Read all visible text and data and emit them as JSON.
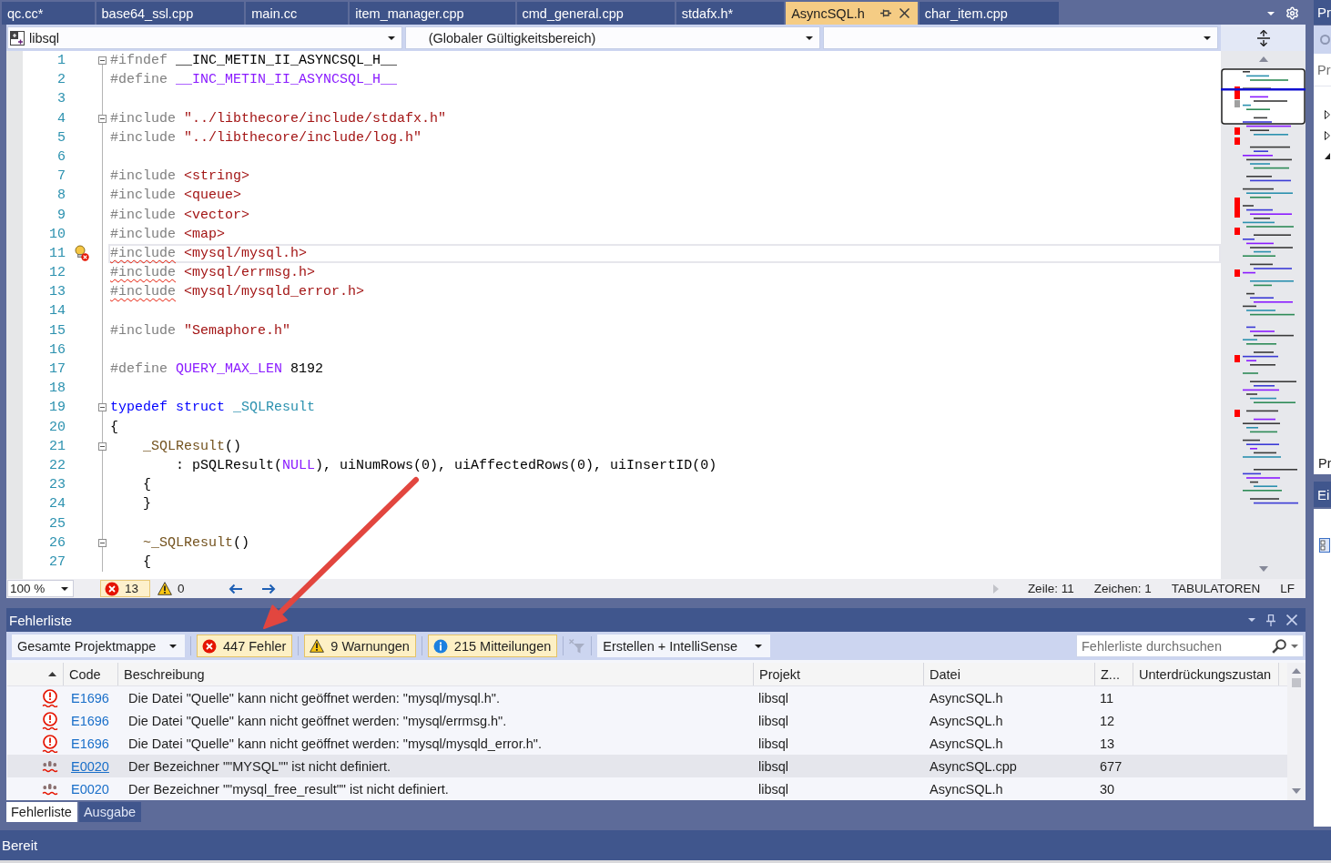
{
  "document_tabs": [
    {
      "label": "qc.cc*",
      "selected": false
    },
    {
      "label": "base64_ssl.cpp",
      "selected": false
    },
    {
      "label": "main.cc",
      "selected": false
    },
    {
      "label": "item_manager.cpp",
      "selected": false
    },
    {
      "label": "cmd_general.cpp",
      "selected": false
    },
    {
      "label": "stdafx.h*",
      "selected": false
    },
    {
      "label": "AsyncSQL.h",
      "selected": true
    },
    {
      "label": "char_item.cpp",
      "selected": false
    }
  ],
  "navigation_bar": {
    "project": "libsql",
    "scope": "(Globaler Gültigkeitsbereich)"
  },
  "editor": {
    "lines": [
      {
        "number": "1",
        "fold": true,
        "current": false,
        "error": false,
        "tokens": [
          {
            "text": "#ifndef",
            "kind": "preprocessor"
          },
          {
            "text": " __INC_METIN_II_ASYNCSQL_H__",
            "kind": "plain"
          }
        ]
      },
      {
        "number": "2",
        "fold": false,
        "current": false,
        "error": false,
        "tokens": [
          {
            "text": "#define",
            "kind": "preprocessor"
          },
          {
            "text": " __INC_METIN_II_ASYNCSQL_H__",
            "kind": "macro"
          }
        ]
      },
      {
        "number": "3",
        "fold": false,
        "current": false,
        "error": false
      },
      {
        "number": "4",
        "fold": true,
        "current": false,
        "error": false,
        "tokens": [
          {
            "text": "#include",
            "kind": "preprocessor"
          },
          {
            "text": " \"../libthecore/include/stdafx.h\"",
            "kind": "string"
          }
        ]
      },
      {
        "number": "5",
        "fold": false,
        "current": false,
        "error": false,
        "tokens": [
          {
            "text": "#include",
            "kind": "preprocessor"
          },
          {
            "text": " \"../libthecore/include/log.h\"",
            "kind": "string"
          }
        ]
      },
      {
        "number": "6",
        "fold": false,
        "current": false,
        "error": false
      },
      {
        "number": "7",
        "fold": false,
        "current": false,
        "error": false,
        "tokens": [
          {
            "text": "#include",
            "kind": "preprocessor"
          },
          {
            "text": " <string>",
            "kind": "string"
          }
        ]
      },
      {
        "number": "8",
        "fold": false,
        "current": false,
        "error": false,
        "tokens": [
          {
            "text": "#include",
            "kind": "preprocessor"
          },
          {
            "text": " <queue>",
            "kind": "string"
          }
        ]
      },
      {
        "number": "9",
        "fold": false,
        "current": false,
        "error": false,
        "tokens": [
          {
            "text": "#include",
            "kind": "preprocessor"
          },
          {
            "text": " <vector>",
            "kind": "string"
          }
        ]
      },
      {
        "number": "10",
        "fold": false,
        "current": false,
        "error": false,
        "tokens": [
          {
            "text": "#include",
            "kind": "preprocessor"
          },
          {
            "text": " <map>",
            "kind": "string"
          }
        ]
      },
      {
        "number": "11",
        "fold": false,
        "current": true,
        "error": true,
        "tokens": [
          {
            "text": "#include",
            "kind": "preprocessor"
          },
          {
            "text": " <mysql/mysql.h>",
            "kind": "string"
          }
        ]
      },
      {
        "number": "12",
        "fold": false,
        "current": false,
        "error": true,
        "tokens": [
          {
            "text": "#include",
            "kind": "preprocessor"
          },
          {
            "text": " <mysql/errmsg.h>",
            "kind": "string"
          }
        ]
      },
      {
        "number": "13",
        "fold": false,
        "current": false,
        "error": true,
        "tokens": [
          {
            "text": "#include",
            "kind": "preprocessor"
          },
          {
            "text": " <mysql/mysqld_error.h>",
            "kind": "string"
          }
        ]
      },
      {
        "number": "14",
        "fold": false,
        "current": false,
        "error": false
      },
      {
        "number": "15",
        "fold": false,
        "current": false,
        "error": false,
        "tokens": [
          {
            "text": "#include",
            "kind": "preprocessor"
          },
          {
            "text": " \"Semaphore.h\"",
            "kind": "string"
          }
        ]
      },
      {
        "number": "16",
        "fold": false,
        "current": false,
        "error": false
      },
      {
        "number": "17",
        "fold": false,
        "current": false,
        "error": false,
        "tokens": [
          {
            "text": "#define",
            "kind": "preprocessor"
          },
          {
            "text": " QUERY_MAX_LEN",
            "kind": "macro"
          },
          {
            "text": " 8192",
            "kind": "plain"
          }
        ]
      },
      {
        "number": "18",
        "fold": false,
        "current": false,
        "error": false
      },
      {
        "number": "19",
        "fold": true,
        "current": false,
        "error": false,
        "tokens": [
          {
            "text": "typedef",
            "kind": "keyword"
          },
          {
            "text": " struct",
            "kind": "keyword"
          },
          {
            "text": " _SQLResult",
            "kind": "type"
          }
        ]
      },
      {
        "number": "20",
        "fold": false,
        "current": false,
        "error": false,
        "tokens": [
          {
            "text": "{",
            "kind": "plain"
          }
        ]
      },
      {
        "number": "21",
        "fold": true,
        "current": false,
        "error": false,
        "tokens": [
          {
            "text": "    _SQLResult",
            "kind": "function"
          },
          {
            "text": "()",
            "kind": "plain"
          }
        ]
      },
      {
        "number": "22",
        "fold": false,
        "current": false,
        "error": false,
        "tokens": [
          {
            "text": "        : pSQLResult(",
            "kind": "plain"
          },
          {
            "text": "NULL",
            "kind": "macro"
          },
          {
            "text": "), uiNumRows(0), uiAffectedRows(0), uiInsertID(0)",
            "kind": "plain"
          }
        ]
      },
      {
        "number": "23",
        "fold": false,
        "current": false,
        "error": false,
        "tokens": [
          {
            "text": "    {",
            "kind": "plain"
          }
        ]
      },
      {
        "number": "24",
        "fold": false,
        "current": false,
        "error": false,
        "tokens": [
          {
            "text": "    }",
            "kind": "plain"
          }
        ]
      },
      {
        "number": "25",
        "fold": false,
        "current": false,
        "error": false
      },
      {
        "number": "26",
        "fold": true,
        "current": false,
        "error": false,
        "tokens": [
          {
            "text": "    ~_SQLResult",
            "kind": "function"
          },
          {
            "text": "()",
            "kind": "plain"
          }
        ]
      },
      {
        "number": "27",
        "fold": false,
        "current": false,
        "error": false,
        "tokens": [
          {
            "text": "    {",
            "kind": "plain"
          }
        ]
      }
    ]
  },
  "editor_status": {
    "zoom": "100 %",
    "issues": [
      {
        "kind": "error",
        "count": "13",
        "selected": true
      },
      {
        "kind": "warning",
        "count": "0",
        "selected": false
      }
    ],
    "line": "Zeile: 11",
    "character": "Zeichen: 1",
    "indentation": "TABULATOREN",
    "line_ending": "LF"
  },
  "error_list": {
    "title": "Fehlerliste",
    "scope": "Gesamte Projektmappe",
    "filters": [
      {
        "kind": "error",
        "label": "447 Fehler",
        "on": true
      },
      {
        "kind": "warning",
        "label": "9 Warnungen",
        "on": true
      },
      {
        "kind": "info",
        "label": "215 Mitteilungen",
        "on": true
      }
    ],
    "source": "Erstellen + IntelliSense",
    "search": {
      "placeholder": "Fehlerliste durchsuchen"
    },
    "columns": [
      "Code",
      "Beschreibung",
      "Projekt",
      "Datei",
      "Z...",
      "Unterdrückungszustan"
    ],
    "rows": [
      {
        "kind": "alert",
        "code": "E1696",
        "description": "Die Datei \"Quelle\" kann nicht geöffnet werden: \"mysql/mysql.h\".",
        "project": "libsql",
        "file": "AsyncSQL.h",
        "line": "11",
        "selected": false
      },
      {
        "kind": "alert",
        "code": "E1696",
        "description": "Die Datei \"Quelle\" kann nicht geöffnet werden: \"mysql/errmsg.h\".",
        "project": "libsql",
        "file": "AsyncSQL.h",
        "line": "12",
        "selected": false
      },
      {
        "kind": "alert",
        "code": "E1696",
        "description": "Die Datei \"Quelle\" kann nicht geöffnet werden: \"mysql/mysqld_error.h\".",
        "project": "libsql",
        "file": "AsyncSQL.h",
        "line": "13",
        "selected": false
      },
      {
        "kind": "spelling",
        "code": "E0020",
        "description": "Der Bezeichner \"\"MYSQL\"\" ist nicht definiert.",
        "project": "libsql",
        "file": "AsyncSQL.cpp",
        "line": "677",
        "selected": true
      },
      {
        "kind": "spelling",
        "code": "E0020",
        "description": "Der Bezeichner \"\"mysql_free_result\"\" ist nicht definiert.",
        "project": "libsql",
        "file": "AsyncSQL.h",
        "line": "30",
        "selected": false
      }
    ],
    "tabs": [
      {
        "label": "Fehlerliste",
        "selected": true
      },
      {
        "label": "Ausgabe",
        "selected": false
      }
    ]
  },
  "side_panels": {
    "explorer_title": "Pr",
    "explorer_search": {
      "placeholder": "Pr"
    },
    "explorer_tab": "Pr",
    "properties_title": "Ei"
  },
  "status_bar": {
    "text": "Bereit"
  }
}
